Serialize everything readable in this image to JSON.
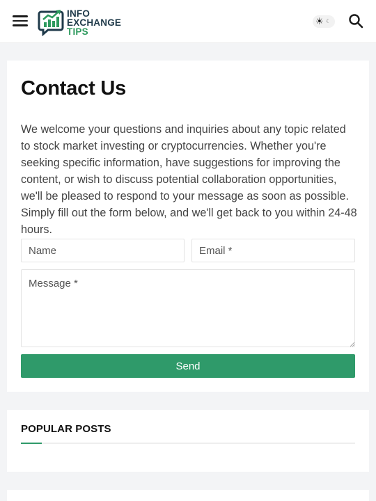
{
  "header": {
    "logo": {
      "line1": "INFO",
      "line2": "EXCHANGE",
      "line3": "TIPS"
    },
    "menu_icon": "hamburger-menu-icon",
    "theme_icons": {
      "light": "sun-icon",
      "dark": "moon-icon"
    },
    "search_icon": "search-icon"
  },
  "contact": {
    "title": "Contact Us",
    "intro": "We welcome your questions and inquiries about any topic related to stock market investing or cryptocurrencies. Whether you're seeking specific information, have suggestions for improving the content, or wish to discuss potential collaboration opportunities, we'll be pleased to respond to your message as soon as possible. Simply fill out the form below, and we'll get back to you within 24-48 hours.",
    "form": {
      "name_placeholder": "Name",
      "email_placeholder": "Email *",
      "message_placeholder": "Message *",
      "name_value": "",
      "email_value": "",
      "message_value": "",
      "send_label": "Send"
    }
  },
  "popular_posts": {
    "title": "POPULAR POSTS"
  },
  "colors": {
    "accent": "#2f9a6a",
    "logo_dark": "#1f3a4a",
    "logo_green": "#2e9a5e",
    "page_bg": "#f3f4f6"
  }
}
